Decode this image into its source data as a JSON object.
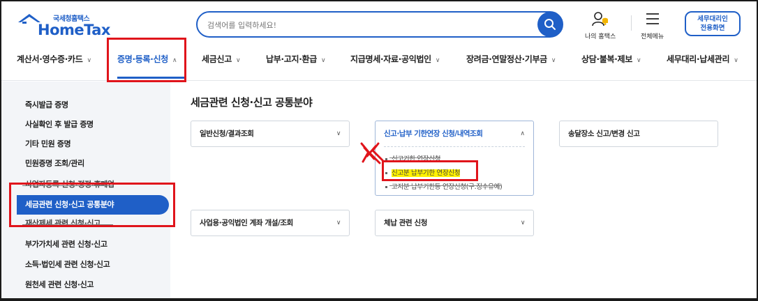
{
  "header": {
    "logo_sub": "국세청홈택스",
    "logo_main": "HomeTax",
    "search_placeholder": "검색어를 입력하세요!",
    "my_hometax": "나의 홈택스",
    "all_menu": "전체메뉴",
    "agent_line1": "세무대리인",
    "agent_line2": "전용화면"
  },
  "gnb": {
    "items": [
      {
        "label": "계산서·영수증·카드"
      },
      {
        "label": "증명·등록·신청"
      },
      {
        "label": "세금신고"
      },
      {
        "label": "납부·고지·환급"
      },
      {
        "label": "지급명세·자료·공익법인"
      },
      {
        "label": "장려금·연말정산·기부금"
      },
      {
        "label": "상담·불복·제보"
      },
      {
        "label": "세무대리·납세관리"
      }
    ]
  },
  "sidebar": {
    "items": [
      {
        "label": "즉시발급 증명"
      },
      {
        "label": "사실확인 후 발급 증명"
      },
      {
        "label": "기타 민원 증명"
      },
      {
        "label": "민원증명 조회/관리"
      },
      {
        "label": "사업자등록 신청·정정·휴폐업"
      },
      {
        "label": "세금관련 신청·신고 공통분야"
      },
      {
        "label": "재산제세 관련 신청·신고"
      },
      {
        "label": "부가가치세 관련 신청·신고"
      },
      {
        "label": "소득·법인세 관련 신청·신고"
      },
      {
        "label": "원천세 관련 신청·신고"
      }
    ]
  },
  "main": {
    "title": "세금관련 신청·신고 공통분야",
    "cards": [
      {
        "label": "일반신청/결과조회"
      },
      {
        "label": "신고·납부 기한연장 신청/내역조회"
      },
      {
        "label": "송달장소 신고/변경 신고"
      },
      {
        "label": "사업용·공익법인 계좌 개설/조회"
      },
      {
        "label": "체납 관련 신청"
      }
    ],
    "sub_items": [
      {
        "label": "신고기한 연장신청"
      },
      {
        "label": "신고분 납부기한 연장신청"
      },
      {
        "label": "고지분 납부기한등 연장신청(구.징수유예)"
      }
    ]
  },
  "colors": {
    "brand": "#1f5fc7",
    "annotation": "#e0141b",
    "highlight": "#fff200"
  }
}
